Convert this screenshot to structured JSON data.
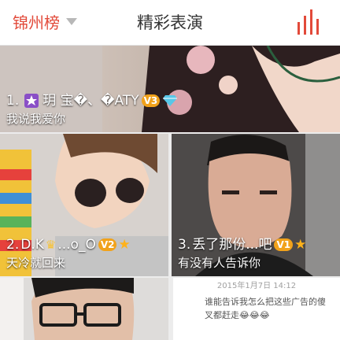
{
  "header": {
    "city": "锦州榜",
    "title": "精彩表演",
    "dropdown_icon": "triangle-down-icon",
    "ranking_icon": "bar-chart-icon",
    "accent": "#e24a3a"
  },
  "cards": [
    {
      "rank": "1.",
      "name": "玥 宝�、�ATY",
      "level": "V3",
      "badges": [
        "vip-level-icon",
        "diamond-icon"
      ],
      "description": "我说我爱你"
    },
    {
      "rank": "2.",
      "name_pre": "D.K",
      "name_post": "...o_O",
      "level": "V2",
      "badges": [
        "crown-icon",
        "vip-level-icon",
        "star-icon"
      ],
      "description": "天冷就回来"
    },
    {
      "rank": "3.",
      "name": "丢了那份...吧",
      "level": "V1",
      "badges": [
        "vip-level-icon",
        "star-icon"
      ],
      "description": "有没有人告诉你"
    }
  ],
  "post": {
    "timestamp": "2015年1月7日 14:12",
    "text": "谁能告诉我怎么把这些广告的傻叉都赶走😂😂😂"
  }
}
